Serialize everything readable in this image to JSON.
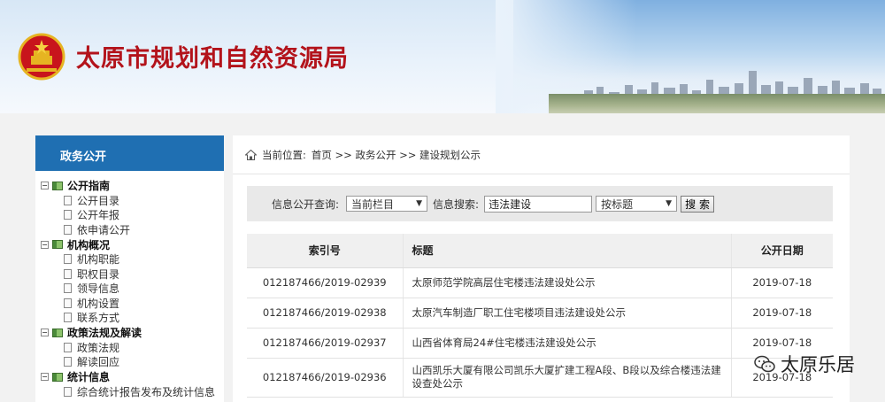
{
  "header": {
    "site_title": "太原市规划和自然资源局",
    "emblem_icon": "national-emblem-icon",
    "brand_color": "#b3131b"
  },
  "sidebar": {
    "heading": "政务公开",
    "heading_color": "#1f6fb2",
    "categories": [
      {
        "label": "公开指南",
        "items": [
          "公开目录",
          "公开年报",
          "依申请公开"
        ]
      },
      {
        "label": "机构概况",
        "items": [
          "机构职能",
          "职权目录",
          "领导信息",
          "机构设置",
          "联系方式"
        ]
      },
      {
        "label": "政策法规及解读",
        "items": [
          "政策法规",
          "解读回应"
        ]
      },
      {
        "label": "统计信息",
        "items": [
          "综合统计报告发布及统计信息"
        ]
      }
    ]
  },
  "breadcrumb": {
    "prefix": "当前位置:",
    "path": "首页 >> 政务公开 >> 建设规划公示"
  },
  "search": {
    "query_label": "信息公开查询:",
    "scope_value": "当前栏目",
    "keyword_label": "信息搜索:",
    "keyword_value": "违法建设",
    "mode_value": "按标题",
    "button_label": "搜 索"
  },
  "table": {
    "headers": [
      "索引号",
      "标题",
      "公开日期"
    ],
    "rows": [
      {
        "index": "012187466/2019-02939",
        "title": "太原师范学院高层住宅楼违法建设处公示",
        "date": "2019-07-18"
      },
      {
        "index": "012187466/2019-02938",
        "title": "太原汽车制造厂职工住宅楼项目违法建设处公示",
        "date": "2019-07-18"
      },
      {
        "index": "012187466/2019-02937",
        "title": "山西省体育局24#住宅楼违法建设处公示",
        "date": "2019-07-18"
      },
      {
        "index": "012187466/2019-02936",
        "title": "山西凯乐大厦有限公司凯乐大厦扩建工程A段、B段以及综合楼违法建设查处公示",
        "date": "2019-07-18"
      }
    ]
  },
  "watermark": {
    "text": "太原乐居",
    "icon": "wechat-icon"
  }
}
